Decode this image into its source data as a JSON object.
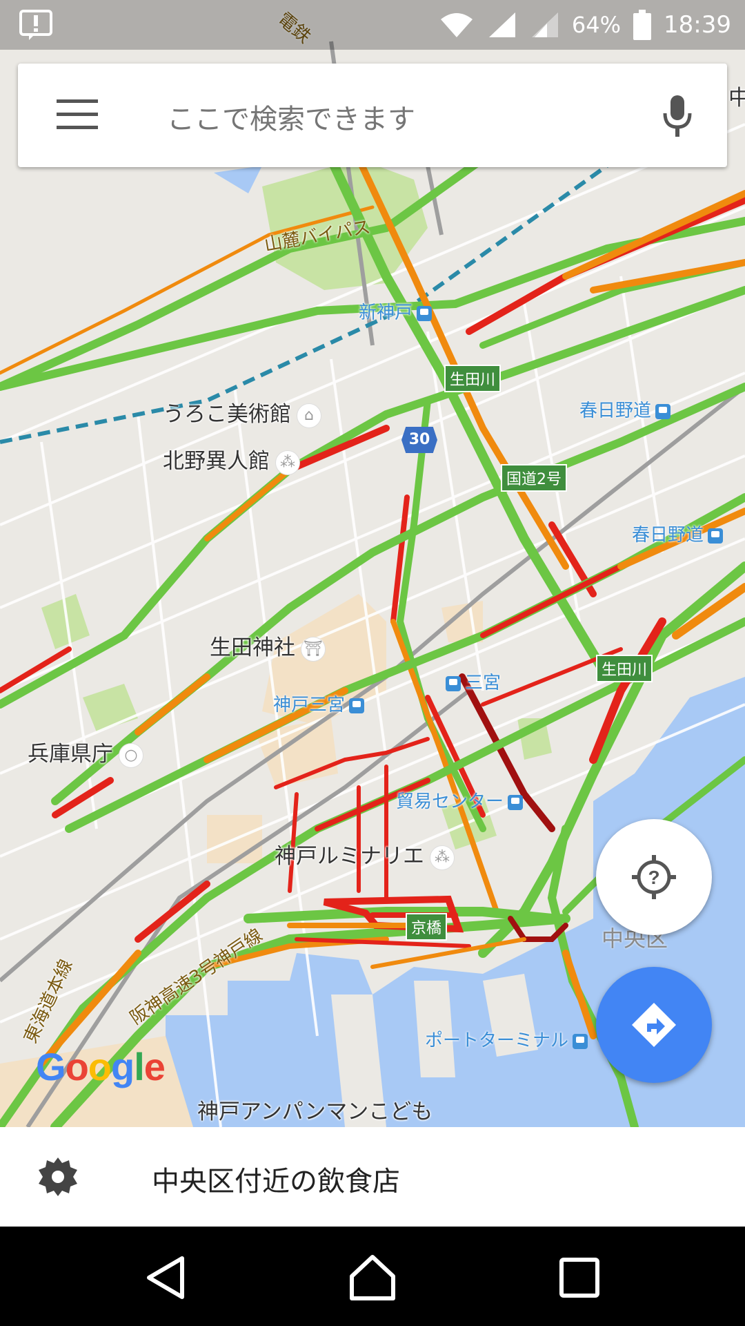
{
  "status_bar": {
    "battery": "64%",
    "time": "18:39"
  },
  "search": {
    "placeholder": "ここで検索できます"
  },
  "map": {
    "labels": {
      "ujiko": "うろこ美術館",
      "kitano": "北野異人館",
      "ikuta_shrine": "生田神社",
      "hyogo_pref": "兵庫県庁",
      "luminarie": "神戸ルミナリエ",
      "anpanman": "神戸アンパンマンこども",
      "chuo_ward": "中央区",
      "top_cut": "中"
    },
    "transit": {
      "shinkobe": "新神戸",
      "kasugano1": "春日野道",
      "kasugano2": "春日野道",
      "kobe_sannomiya": "神戸三宮",
      "sannomiya": "三宮",
      "boeki": "貿易センター",
      "port_terminal": "ポートターミナル"
    },
    "road_signs": {
      "ikutagawa1": "生田川",
      "kokudo2": "国道2号",
      "ikutagawa2": "生田川",
      "kyobashi": "京橋"
    },
    "route_shield": "30",
    "road_names": {
      "sanroku": "山麓バイパス",
      "hanshin": "阪神高速3号神戸線",
      "tokaido": "東海道本線",
      "railway_top": "電鉄"
    },
    "attribution": "Google",
    "traffic_colors": {
      "fast": "#6cc644",
      "medium": "#f08a0e",
      "slow": "#e3231a",
      "very_slow": "#a01010"
    }
  },
  "bottom_sheet": {
    "text": "中央区付近の飲食店"
  }
}
